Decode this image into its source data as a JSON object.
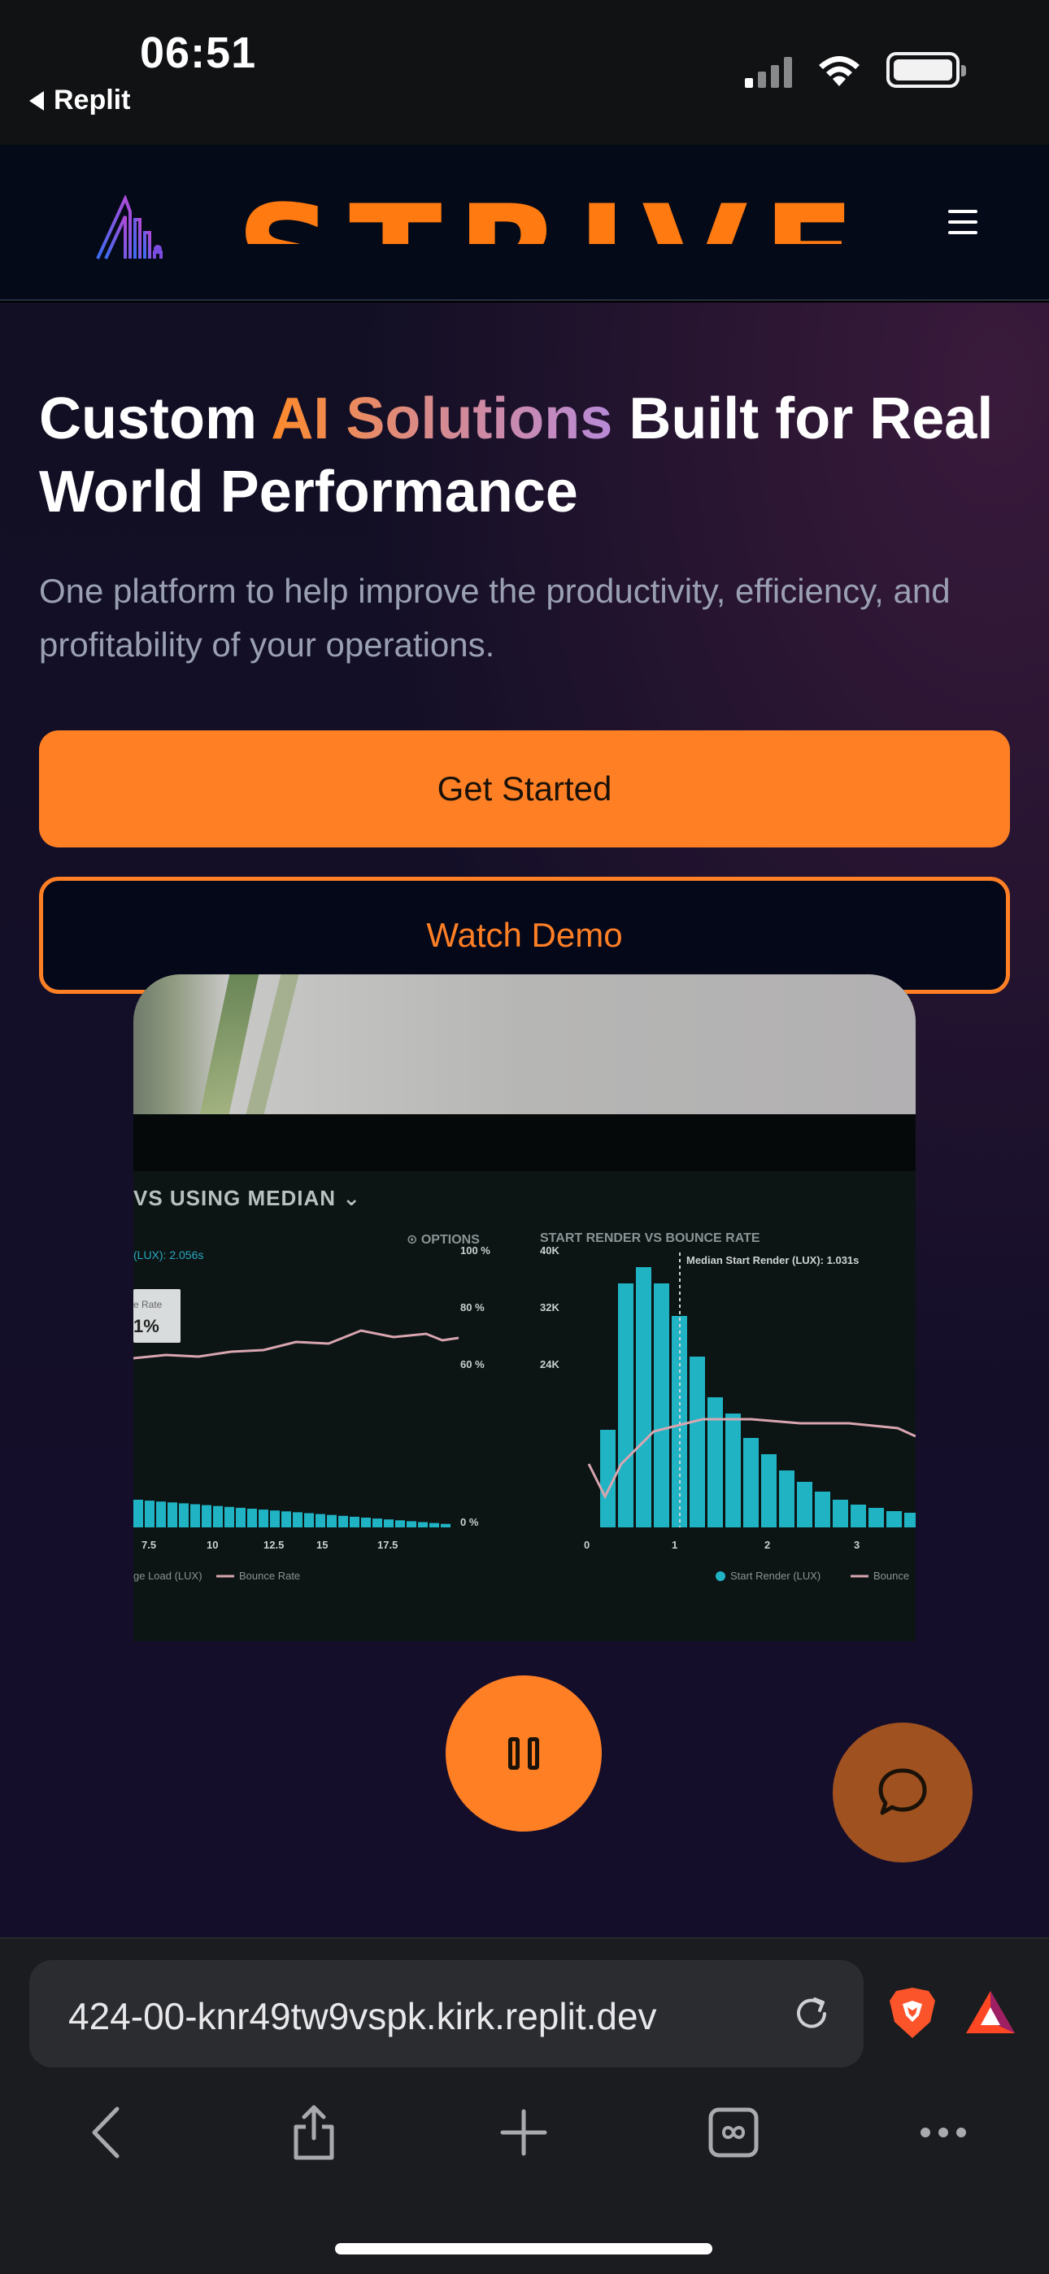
{
  "status_bar": {
    "time": "06:51",
    "back_app": "Replit",
    "icons": [
      "signal-icon",
      "wifi-icon",
      "battery-icon"
    ]
  },
  "header": {
    "logo_text": "STRIVE",
    "logo_icon": "logo-mark-icon",
    "menu_icon": "hamburger-icon"
  },
  "hero": {
    "title_start": "Custom ",
    "title_accent": "AI Solutions",
    "title_end": " Built for Real World Performance",
    "subtitle": "One platform to help improve the productivity, efficiency, and profitability of your operations.",
    "primary_cta": "Get Started",
    "secondary_cta": "Watch Demo",
    "carousel": {
      "count": 4,
      "active_index": 1
    }
  },
  "media": {
    "heading": "VS USING MEDIAN",
    "options_label": "OPTIONS",
    "right_title": "START RENDER VS BOUNCE RATE",
    "left_annotation": "(LUX): 2.056s",
    "left_tag_label": "e Rate",
    "left_tag_value": "1%",
    "median_label": "Median Start Render (LUX): 1.031s",
    "pct_ticks": [
      "100 %",
      "80 %",
      "60 %",
      "0 %"
    ],
    "count_ticks": [
      "40K",
      "32K",
      "24K"
    ],
    "left_x_ticks": [
      "7.5",
      "10",
      "12.5",
      "15",
      "17.5"
    ],
    "right_x_ticks": [
      "0",
      "1",
      "2",
      "3"
    ],
    "left_legend": "ge Load (LUX)",
    "left_legend_2": "Bounce Rate",
    "right_legend": "Start Render (LUX)",
    "right_legend_2": "Bounce",
    "pause_icon": "pause-icon",
    "chat_icon": "chat-bubble-icon"
  },
  "browser": {
    "url": "424-00-knr49tw9vspk.kirk.replit.dev",
    "toolbar_icons": [
      "back-icon",
      "share-icon",
      "new-tab-icon",
      "tabs-icon",
      "more-icon"
    ]
  },
  "colors": {
    "accent": "#ff7f25",
    "dot_inactive": "#7a2bb8",
    "bar_teal": "#1fb3c4"
  }
}
